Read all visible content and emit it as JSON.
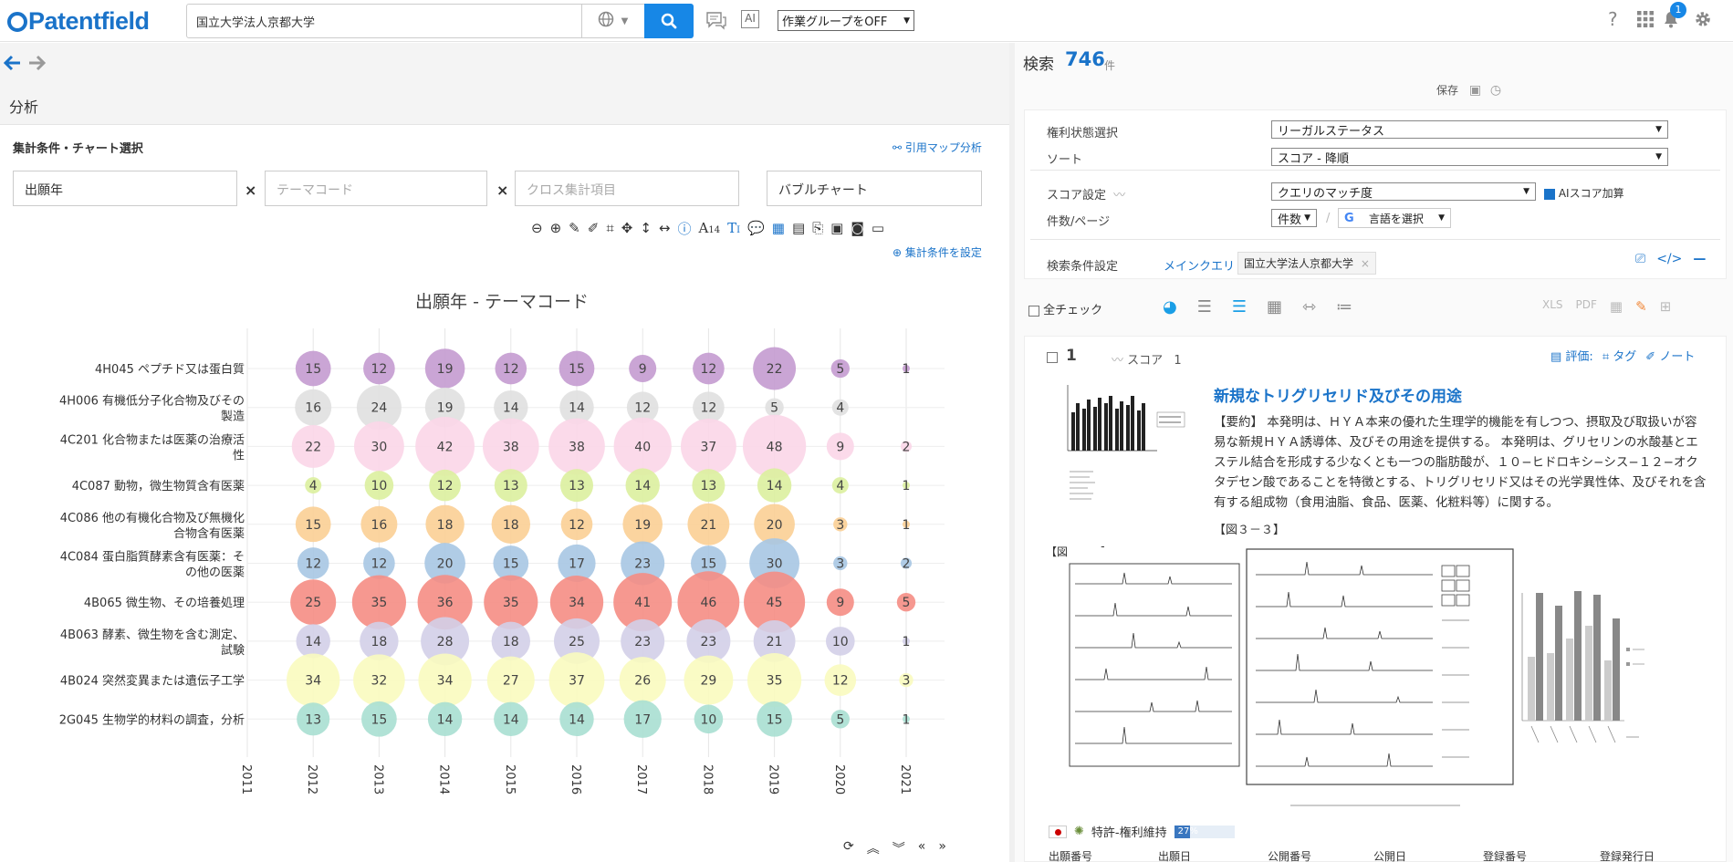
{
  "header": {
    "logo_text": "Patentfield",
    "search_value": "国立大学法人京都大学",
    "ai_label": "AI",
    "workgroup": "作業グループをOFF",
    "notification_count": "1"
  },
  "left": {
    "section": "分析",
    "config_title": "集計条件・チャート選択",
    "citation_map": "引用マップ分析",
    "axis1": "出願年",
    "axis2_placeholder": "テーマコード",
    "cross_placeholder": "クロス集計項目",
    "chart_type": "バブルチャート",
    "font_size_indicator": "14",
    "set_conditions": "集計条件を設定"
  },
  "chart_data": {
    "type": "scatter",
    "title": "出願年 - テーマコード",
    "x": [
      "2011",
      "2012",
      "2013",
      "2014",
      "2015",
      "2016",
      "2017",
      "2018",
      "2019",
      "2020",
      "2021"
    ],
    "y": [
      "4H045 ペプチド又は蛋白質",
      "4H006 有機低分子化合物及びその製造",
      "4C201 化合物または医薬の治療活性",
      "4C087 動物，微生物質含有医薬",
      "4C086 他の有機化合物及び無機化合物含有医薬",
      "4C084 蛋白脂質酵素含有医薬：その他の医薬",
      "4B065 微生物、その培養処理",
      "4B063 酵素、微生物を含む測定、試験",
      "4B024 突然変異または遺伝子工学",
      "2G045 生物学的材料の調査，分析"
    ],
    "colors": [
      "#c49bd0",
      "#e0e0e0",
      "#fbd6e8",
      "#dcef9f",
      "#fbcf95",
      "#a7c7e3",
      "#f58d84",
      "#d3cfe8",
      "#fafbbf",
      "#a9dfd2"
    ],
    "values": [
      [
        0,
        15,
        12,
        19,
        12,
        15,
        9,
        12,
        22,
        5,
        1
      ],
      [
        0,
        16,
        24,
        19,
        14,
        14,
        12,
        12,
        5,
        4,
        0
      ],
      [
        0,
        22,
        30,
        42,
        38,
        38,
        40,
        37,
        48,
        9,
        2
      ],
      [
        0,
        4,
        10,
        12,
        13,
        13,
        14,
        13,
        14,
        4,
        1
      ],
      [
        0,
        15,
        16,
        18,
        18,
        12,
        19,
        21,
        20,
        3,
        1
      ],
      [
        0,
        12,
        12,
        20,
        15,
        17,
        23,
        15,
        30,
        3,
        2
      ],
      [
        0,
        25,
        35,
        36,
        35,
        34,
        41,
        46,
        45,
        9,
        5
      ],
      [
        0,
        14,
        18,
        28,
        18,
        25,
        23,
        23,
        21,
        10,
        1
      ],
      [
        0,
        34,
        32,
        34,
        27,
        37,
        26,
        29,
        35,
        12,
        3
      ],
      [
        0,
        13,
        15,
        14,
        14,
        14,
        17,
        10,
        15,
        5,
        1
      ]
    ]
  },
  "right": {
    "search_label": "検索",
    "count": "746",
    "count_unit": "件",
    "save_label": "保存",
    "rights_label": "権利状態選択",
    "rights_value": "リーガルステータス",
    "sort_label": "ソート",
    "sort_value": "スコア - 降順",
    "score_label": "スコア設定",
    "score_value": "クエリのマッチ度",
    "ai_score": "AIスコア加算",
    "perpage_label": "件数/ページ",
    "perpage_value": "件数",
    "lang_select": "言語を選択",
    "cond_label": "検索条件設定",
    "main_query": "メインクエリ",
    "query_tag": "国立大学法人京都大学",
    "check_all": "全チェック",
    "result_number": "1",
    "score_text": "スコア",
    "score_val": "1",
    "eval": "評価:",
    "tag": "タグ",
    "note": "ノート",
    "title": "新規なトリグリセリド及びその用途",
    "abstract": "【要約】 本発明は、ＨＹＡ本来の優れた生理学的機能を有しつつ、摂取及び取扱いが容易な新規ＨＹＡ誘導体、及びその用途を提供する。 本発明は、グリセリンの水酸基とエステル結合を形成する少なくとも一つの脂肪酸が、１０−ヒドロキシ−シス−１２−オクタデセン酸であることを特徴とする、トリグリセリド又はその光学異性体、及びそれを含有する組成物（食用油脂、食品、医薬、化粧料等）に関する。",
    "fig33": "【図３－３】",
    "fig32": "【図３－２】",
    "status": "特許-権利維持",
    "progress": "27%",
    "progress_value": 27,
    "fields": [
      "出願番号",
      "出願日",
      "公開番号",
      "公開日",
      "登録番号",
      "登録発行日"
    ]
  }
}
